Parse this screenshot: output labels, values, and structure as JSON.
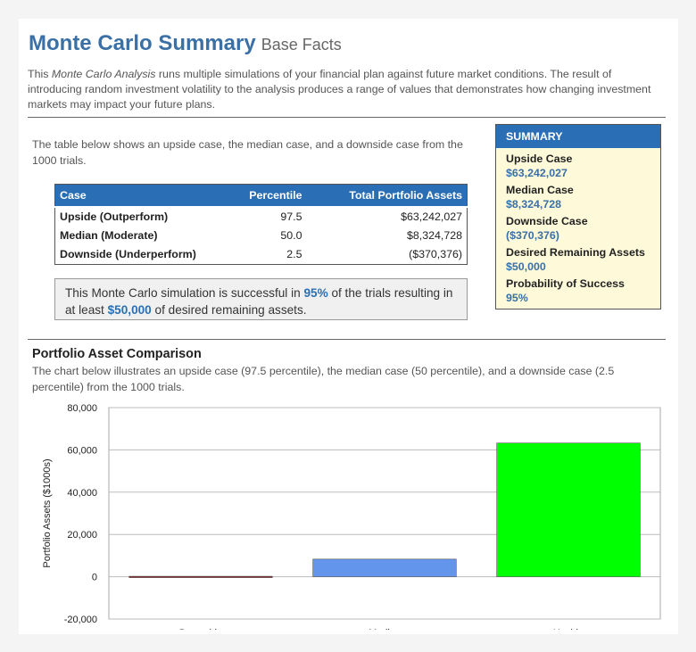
{
  "header": {
    "title": "Monte Carlo Summary",
    "subtitle": "Base Facts"
  },
  "intro": {
    "before": "This ",
    "emphasis": "Monte Carlo Analysis",
    "after": " runs multiple simulations of your financial plan against future market conditions. The result of introducing random investment volatility to the analysis produces a range of values that demonstrates how changing investment markets may impact your future plans."
  },
  "table_desc": "The table below shows an upside case, the median case, and a downside case from the 1000 trials.",
  "table": {
    "headers": [
      "Case",
      "Percentile",
      "Total Portfolio Assets"
    ],
    "rows": [
      [
        "Upside (Outperform)",
        "97.5",
        "$63,242,027"
      ],
      [
        "Median (Moderate)",
        "50.0",
        "$8,324,728"
      ],
      [
        "Downside (Underperform)",
        "2.5",
        "($370,376)"
      ]
    ]
  },
  "success": {
    "t1": "This Monte Carlo simulation is successful in ",
    "pct": "95%",
    "t2": " of the trials resulting in at least ",
    "amount": "$50,000",
    "t3": " of desired remaining assets."
  },
  "summary": {
    "heading": "SUMMARY",
    "items": [
      {
        "label": "Upside Case",
        "value": "$63,242,027"
      },
      {
        "label": "Median Case",
        "value": "$8,324,728"
      },
      {
        "label": "Downside Case",
        "value": "($370,376)"
      },
      {
        "label": "Desired Remaining Assets",
        "value": "$50,000"
      },
      {
        "label": "Probability of Success",
        "value": "95%"
      }
    ]
  },
  "chart_section": {
    "title": "Portfolio Asset Comparison",
    "desc": "The chart below illustrates an upside case (97.5 percentile), the median case (50 percentile), and a downside case (2.5 percentile) from the 1000 trials."
  },
  "colors": {
    "accent": "#2a6fb5",
    "downside_bar": "#8b1a1a",
    "median_bar": "#6495ed",
    "upside_bar": "#00ff00"
  },
  "chart_data": {
    "type": "bar",
    "categories": [
      "Downside",
      "Median",
      "Upside"
    ],
    "values": [
      -370,
      8325,
      63242
    ],
    "title": "",
    "xlabel": "",
    "ylabel": "Portfolio Assets ($1000s)",
    "ylim": [
      -20000,
      80000
    ],
    "yticks": [
      -20000,
      0,
      20000,
      40000,
      60000,
      80000
    ],
    "ytick_labels": [
      "-20,000",
      "0",
      "20,000",
      "40,000",
      "60,000",
      "80,000"
    ],
    "grid": true,
    "legend": "none"
  }
}
